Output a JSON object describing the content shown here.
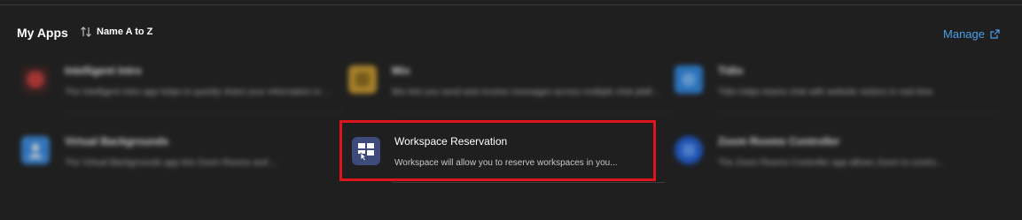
{
  "header": {
    "title": "My Apps",
    "sort_label": "Name A to Z",
    "manage_label": "Manage"
  },
  "apps": [
    {
      "name": "Intelligent Intro",
      "description": "The Intelligent Intro app helps to quickly share your information in meetings",
      "icon_color": "#e03a3a",
      "icon": "red-circle-icon"
    },
    {
      "name": "Mio",
      "description": "Mio lets you send and receive messages across multiple chat platforms",
      "icon_color": "#e0b23a",
      "icon": "yellow-app-icon"
    },
    {
      "name": "Tidio",
      "description": "Tidio helps teams chat with website visitors in real time",
      "icon_color": "#3a9ae0",
      "icon": "blue-app-icon"
    },
    {
      "name": "Virtual Backgrounds",
      "description": "The Virtual Backgrounds app lets Zoom Rooms and ...",
      "icon_color": "#3a8ae0",
      "icon": "person-icon"
    },
    {
      "name": "Workspace Reservation",
      "description": "Workspace will allow you to reserve workspaces in you...",
      "icon_color": "#3d4a7a",
      "icon": "workspace-reservation-icon"
    },
    {
      "name": "Zoom Rooms Controller",
      "description": "The Zoom Rooms Controller app allows Zoom to contro...",
      "icon_color": "#2d6ee0",
      "icon": "rooms-controller-icon"
    }
  ]
}
